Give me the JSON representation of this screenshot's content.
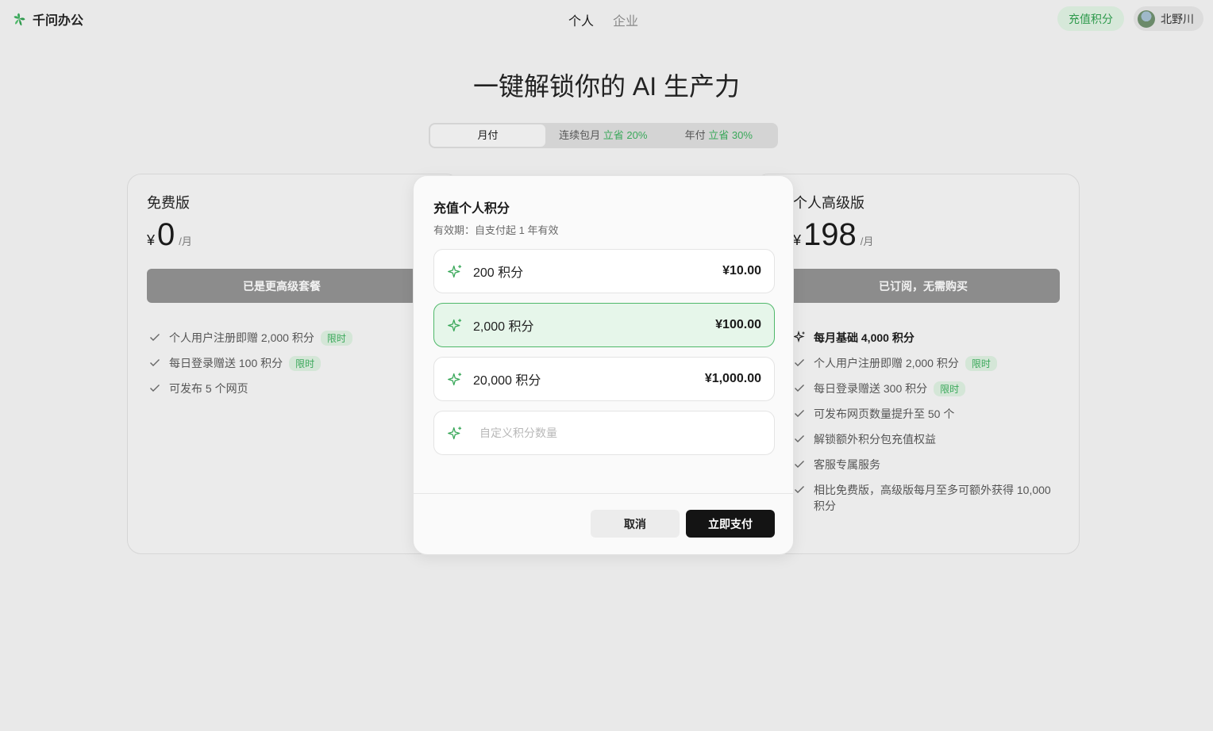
{
  "header": {
    "logo_text": "千问办公",
    "nav": [
      {
        "label": "个人",
        "active": true
      },
      {
        "label": "企业",
        "active": false
      }
    ],
    "recharge_label": "充值积分",
    "user_name": "北野川"
  },
  "hero": {
    "title": "一键解锁你的 AI 生产力"
  },
  "billing": {
    "monthly": "月付",
    "continuous": "连续包月",
    "continuous_save": "立省 20%",
    "yearly": "年付",
    "yearly_save": "立省 30%"
  },
  "plans": {
    "free": {
      "name": "免费版",
      "currency": "¥",
      "price": "0",
      "period": "/月",
      "button": "已是更高级套餐",
      "features": [
        {
          "text": "个人用户注册即赠 2,000 积分",
          "tag": "限时"
        },
        {
          "text": "每日登录赠送 100 积分",
          "tag": "限时"
        },
        {
          "text": "可发布 5 个网页",
          "tag": ""
        }
      ]
    },
    "pro": {
      "name": "个人高级版",
      "currency": "¥",
      "price": "198",
      "period": "/月",
      "button": "已订阅，无需购买",
      "highlight": "每月基础 4,000 积分",
      "features": [
        {
          "text": "个人用户注册即赠 2,000 积分",
          "tag": "限时"
        },
        {
          "text": "每日登录赠送 300 积分",
          "tag": "限时"
        },
        {
          "text": "可发布网页数量提升至 50 个",
          "tag": ""
        },
        {
          "text": "解锁额外积分包充值权益",
          "tag": ""
        },
        {
          "text": "客服专属服务",
          "tag": ""
        },
        {
          "text": "相比免费版，高级版每月至多可额外获得 10,000 积分",
          "tag": ""
        }
      ]
    }
  },
  "modal": {
    "title": "充值个人积分",
    "subtitle": "有效期：自支付起 1 年有效",
    "options": [
      {
        "points": "200 积分",
        "price": "¥10.00",
        "selected": false
      },
      {
        "points": "2,000 积分",
        "price": "¥100.00",
        "selected": true
      },
      {
        "points": "20,000 积分",
        "price": "¥1,000.00",
        "selected": false
      }
    ],
    "custom_placeholder": "自定义积分数量",
    "cancel_label": "取消",
    "pay_label": "立即支付"
  },
  "colors": {
    "accent_green": "#3aa85a",
    "selected_bg": "#e6f6ea",
    "pay_button": "#141414"
  }
}
